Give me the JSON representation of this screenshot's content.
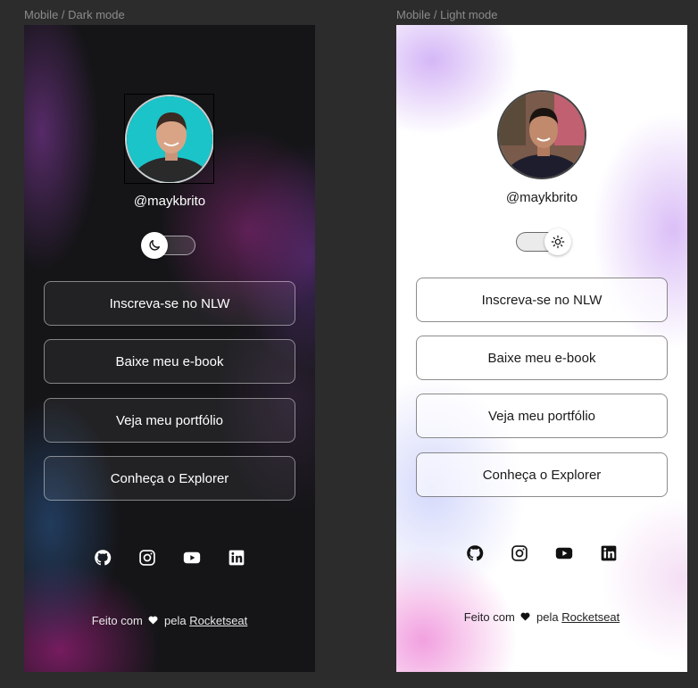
{
  "frames": {
    "dark": {
      "label": "Mobile / Dark mode"
    },
    "light": {
      "label": "Mobile / Light mode"
    }
  },
  "profile": {
    "username": "@maykbrito"
  },
  "links": [
    {
      "label": "Inscreva-se no NLW"
    },
    {
      "label": "Baixe meu e-book"
    },
    {
      "label": "Veja meu portfólio"
    },
    {
      "label": "Conheça o Explorer"
    }
  ],
  "socials": [
    "github-icon",
    "instagram-icon",
    "youtube-icon",
    "linkedin-icon"
  ],
  "footer": {
    "made_with": "Feito com",
    "by": "pela",
    "brand": "Rocketseat"
  },
  "colors": {
    "canvas": "#2c2c2c",
    "dark_bg": "#151518",
    "light_bg": "#ffffff"
  }
}
